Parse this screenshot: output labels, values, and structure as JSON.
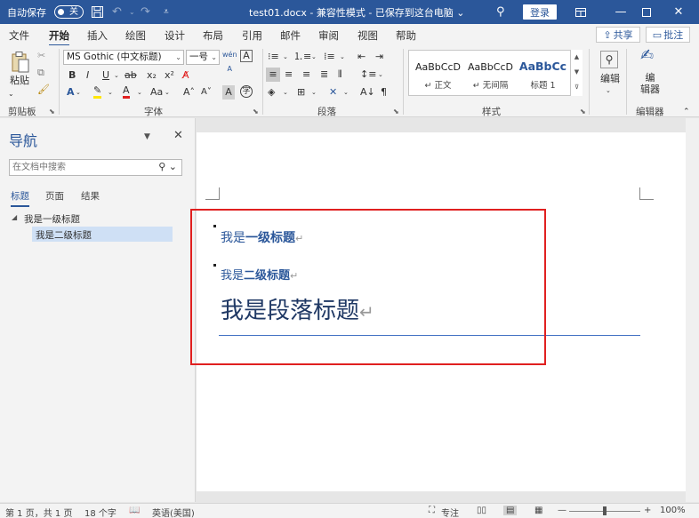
{
  "titlebar": {
    "autosave_label": "自动保存",
    "autosave_state": "关",
    "doc_title": "test01.docx  -  兼容性模式  -  已保存到这台电脑 ⌄",
    "login_label": "登录"
  },
  "menu": {
    "tabs": [
      "文件",
      "开始",
      "插入",
      "绘图",
      "设计",
      "布局",
      "引用",
      "邮件",
      "审阅",
      "视图",
      "帮助"
    ],
    "share_label": "共享",
    "comment_label": "批注"
  },
  "ribbon": {
    "clipboard_label": "剪贴板",
    "paste_label": "粘贴",
    "font_label": "字体",
    "font_name": "MS Gothic (中文标题)",
    "font_size": "一号",
    "paragraph_label": "段落",
    "styles_label": "样式",
    "styles": [
      {
        "sample": "AaBbCcD",
        "name": "↵ 正文"
      },
      {
        "sample": "AaBbCcD",
        "name": "↵ 无间隔"
      },
      {
        "sample": "AaBbCc",
        "name": "标题 1"
      }
    ],
    "editing_group_btn": "编辑",
    "editor_label": "编辑器",
    "editor_btn": "编\n辑器"
  },
  "nav": {
    "title": "导航",
    "search_placeholder": "在文档中搜索",
    "tabs": [
      "标题",
      "页面",
      "结果"
    ],
    "items": [
      {
        "label": "我是一级标题"
      },
      {
        "label": "我是二级标题"
      }
    ]
  },
  "document": {
    "h1_prefix": "我是",
    "h1_bold": "一级标题",
    "h2_prefix": "我是",
    "h2_bold": "二级标题",
    "title": "我是段落标题",
    "para_mark": "↵"
  },
  "status": {
    "page": "第 1 页，共 1 页",
    "words": "18 个字",
    "language": "英语(美国)",
    "focus": "专注",
    "zoom": "100%"
  },
  "colors": {
    "accent": "#2b579a",
    "highlight_box": "#e02020"
  }
}
